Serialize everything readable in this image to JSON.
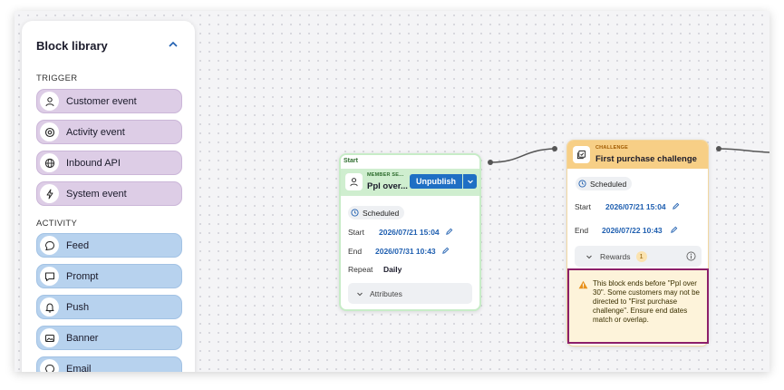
{
  "sidebar": {
    "title": "Block library",
    "trigger_section": "TRIGGER",
    "trigger_items": [
      {
        "label": "Customer event",
        "icon": "person-icon"
      },
      {
        "label": "Activity event",
        "icon": "target-icon"
      },
      {
        "label": "Inbound API",
        "icon": "globe-icon"
      },
      {
        "label": "System event",
        "icon": "lightning-icon"
      }
    ],
    "activity_section": "ACTIVITY",
    "activity_items": [
      {
        "label": "Feed",
        "icon": "chat-bubble-icon"
      },
      {
        "label": "Prompt",
        "icon": "message-square-icon"
      },
      {
        "label": "Push",
        "icon": "bell-icon"
      },
      {
        "label": "Banner",
        "icon": "image-icon"
      },
      {
        "label": "Email",
        "icon": "chat-bubble-icon"
      }
    ]
  },
  "start_node": {
    "tab": "Start",
    "kind": "MEMBER SE...",
    "title": "Ppl over...",
    "unpublish": "Unpublish",
    "status": "Scheduled",
    "start_label": "Start",
    "start_value": "2026/07/21 15:04",
    "end_label": "End",
    "end_value": "2026/07/31 10:43",
    "repeat_label": "Repeat",
    "repeat_value": "Daily",
    "attributes": "Attributes"
  },
  "challenge_node": {
    "kind": "CHALLENGE",
    "title": "First purchase challenge",
    "status": "Scheduled",
    "start_label": "Start",
    "start_value": "2026/07/21 15:04",
    "end_label": "End",
    "end_value": "2026/07/22 10:43",
    "rewards": "Rewards",
    "rewards_count": "1",
    "warning": "This block ends before \"Ppl over 30\". Some customers may not be directed to \"First purchase challenge\". Ensure end dates match or overlap."
  },
  "colors": {
    "trigger": "#ddcde6",
    "activity": "#b7d2ee",
    "start_green": "#cfeecf",
    "challenge_orange": "#f7cf86",
    "primary_blue": "#1f6fc4",
    "warning_border": "#8c1f6a"
  }
}
